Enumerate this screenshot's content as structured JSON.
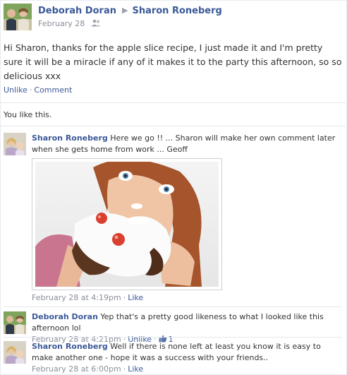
{
  "post": {
    "author": "Deborah Doran",
    "target": "Sharon Roneberg",
    "date": "February 28",
    "audience_icon": "friends-icon",
    "text": "Hi Sharon, thanks for the apple slice recipe, I just made it and I'm pretty sure it will be a miracle if any of it makes it to the party this afternoon, so so delicious xxx",
    "actions": {
      "unlike": "Unlike",
      "comment": "Comment",
      "separator": "·"
    },
    "likes_text": "You like this."
  },
  "comments": [
    {
      "author": "Sharon Roneberg",
      "text": "Here we go !! ... Sharon will make her own comment later when she gets home from work ... Geoff",
      "timestamp": "February 28 at 4:19pm",
      "action": "Like",
      "has_photo": true
    },
    {
      "author": "Deborah Doran",
      "text": "Yep that's a pretty good likeness to what I looked like this afternoon lol",
      "timestamp": "February 28 at 4:21pm",
      "action": "Unlike",
      "like_count": "1"
    },
    {
      "author": "Sharon Roneberg",
      "text": "Well if there is none left at least you know it is easy to make another one - hope it was a success with your friends..",
      "timestamp": "February 28 at 6:00pm",
      "action": "Like"
    }
  ],
  "colors": {
    "link": "#3b5998",
    "meta": "#8a8f99",
    "separator": "#e5e8ee"
  }
}
